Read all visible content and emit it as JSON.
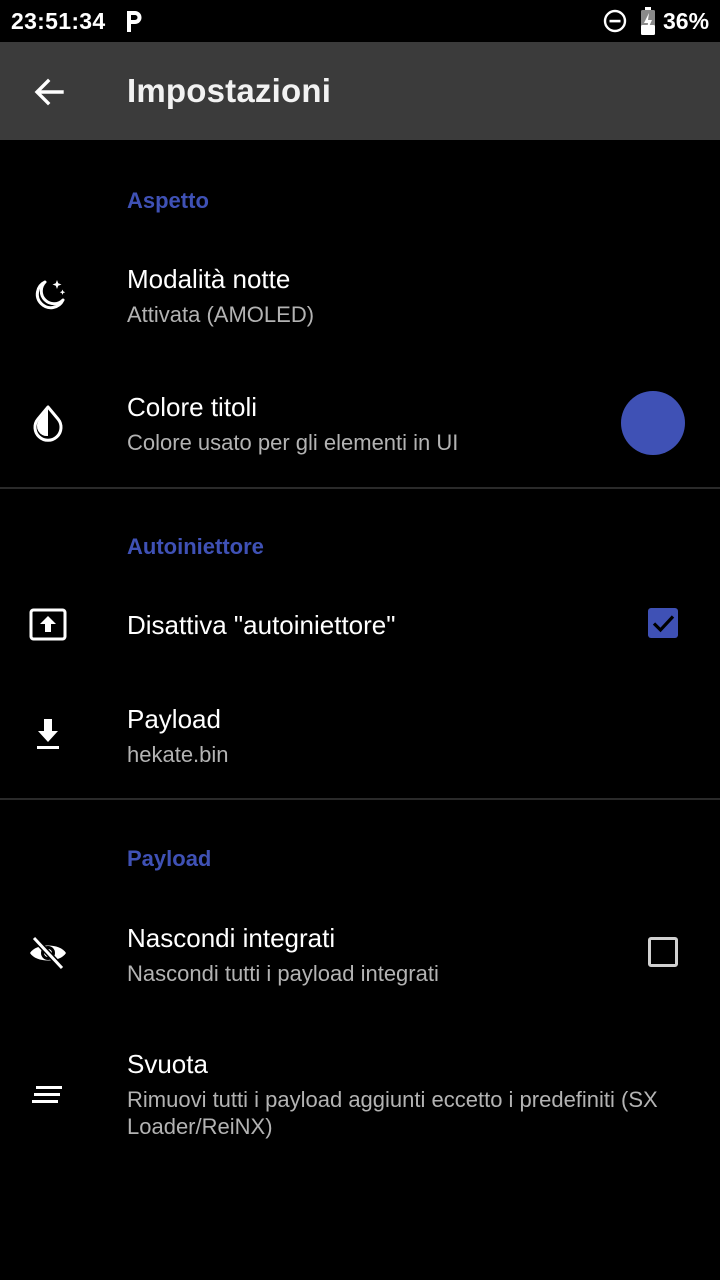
{
  "status_bar": {
    "time": "23:51:34",
    "battery": "36%"
  },
  "app_bar": {
    "title": "Impostazioni"
  },
  "sections": {
    "appearance": {
      "header": "Aspetto",
      "night_mode": {
        "title": "Modalità notte",
        "summary": "Attivata (AMOLED)"
      },
      "title_color": {
        "title": "Colore titoli",
        "summary": "Colore usato per gli elementi in UI",
        "color": "#3f51b5"
      }
    },
    "autoinjector": {
      "header": "Autoiniettore",
      "disable": {
        "title": "Disattiva \"autoiniettore\"",
        "checked": true
      },
      "payload": {
        "title": "Payload",
        "summary": "hekate.bin"
      }
    },
    "payload": {
      "header": "Payload",
      "hide_builtin": {
        "title": "Nascondi integrati",
        "summary": "Nascondi tutti i payload integrati",
        "checked": false
      },
      "clear": {
        "title": "Svuota",
        "summary": "Rimuovi tutti i payload aggiunti eccetto i predefiniti (SX Loader/ReiNX)"
      }
    }
  },
  "colors": {
    "accent": "#3f51b5",
    "app_bar": "#3b3b3b",
    "background": "#000000"
  }
}
